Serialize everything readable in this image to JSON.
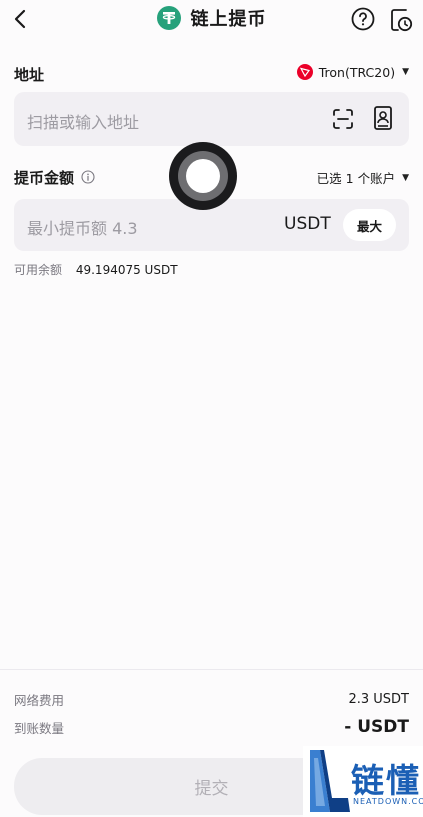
{
  "header": {
    "title": "链上提币",
    "coin_icon": "usdt-tether-icon",
    "back_icon": "chevron-left-icon",
    "help_icon": "question-circle-icon",
    "history_icon": "clock-document-icon",
    "coin_color": "#26a17b"
  },
  "address": {
    "label": "地址",
    "network": "Tron(TRC20)",
    "network_icon": "tron-icon",
    "network_color": "#eb0029",
    "placeholder": "扫描或输入地址",
    "scan_icon": "scan-icon",
    "addressbook_icon": "address-book-icon"
  },
  "amount": {
    "label": "提币金额",
    "info_icon": "info-circle-icon",
    "account_selector": "已选 1 个账户",
    "placeholder": "最小提币额 4.3",
    "unit": "USDT",
    "max_label": "最大"
  },
  "balance": {
    "label": "可用余额",
    "value": "49.194075 USDT"
  },
  "footer": {
    "fee_label": "网络费用",
    "fee_value": "2.3 USDT",
    "receive_label": "到账数量",
    "receive_value": "- USDT",
    "submit_label": "提交"
  },
  "watermark": {
    "text": "链懂",
    "sub": "NEATDOWN.COM",
    "color": "#1b5fb5"
  }
}
